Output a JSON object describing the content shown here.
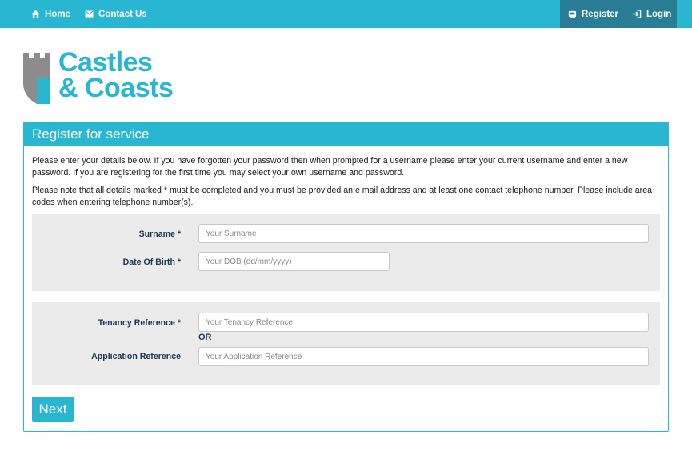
{
  "nav": {
    "home_label": "Home",
    "contact_label": "Contact Us",
    "register_label": "Register",
    "login_label": "Login"
  },
  "logo": {
    "line1": "Castles",
    "line2": "& Coasts"
  },
  "panel": {
    "title": "Register for service",
    "intro_1": "Please enter your details below. If you have forgotten your password then when prompted for a username please enter your current username and enter a new password. If you are registering for the first time you may select your own username and password.",
    "intro_2": "Please note that all details marked * must be completed and you must be provided an e mail address and at least one contact telephone number. Please include area codes when entering telephone number(s)."
  },
  "form": {
    "surname": {
      "label": "Surname *",
      "placeholder": "Your Surname",
      "value": ""
    },
    "dob": {
      "label": "Date Of Birth *",
      "placeholder": "Your DOB (dd/mm/yyyy)",
      "value": ""
    },
    "tenancy": {
      "label": "Tenancy Reference *",
      "placeholder": "Your Tenancy Reference",
      "value": ""
    },
    "or_label": "OR",
    "application": {
      "label": "Application Reference",
      "placeholder": "Your Application Reference",
      "value": ""
    },
    "next_label": "Next"
  },
  "colors": {
    "brand": "#29b6d1",
    "nav_dark": "#2a7d96",
    "label_text": "#1c3553",
    "logo_grey": "#8c8c8c"
  },
  "icons": {
    "home": "home-icon",
    "contact": "envelope-icon",
    "register": "register-icon",
    "login": "login-icon",
    "logo": "castle-tower-icon"
  }
}
